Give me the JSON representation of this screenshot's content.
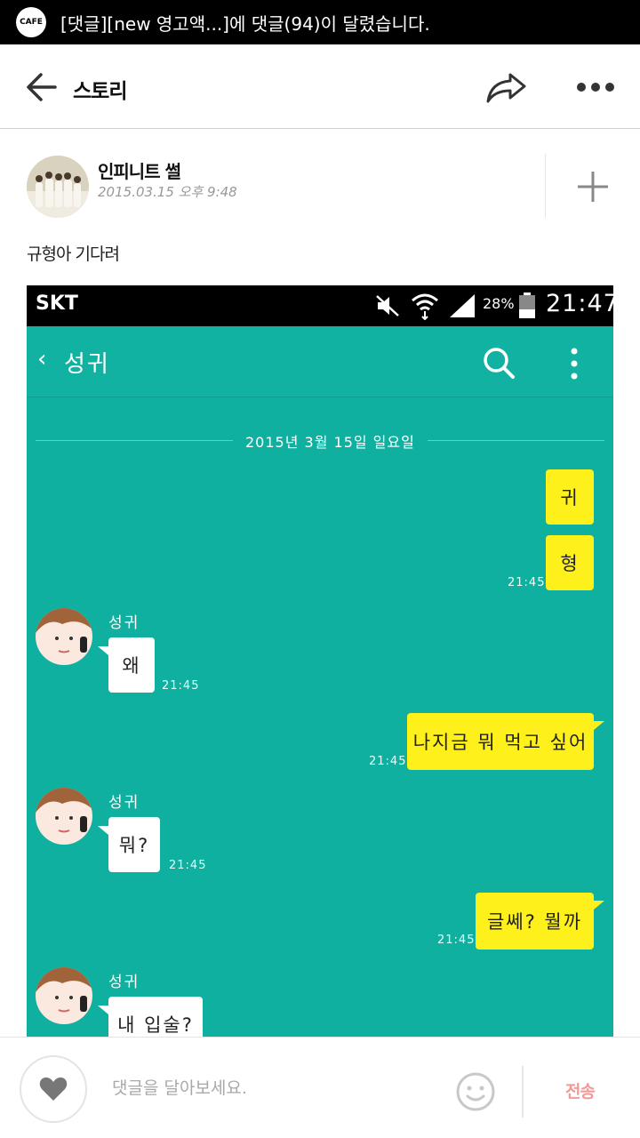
{
  "notification": {
    "text": "[댓글][new 영고액...]에 댓글(94)이 달렸습니다.",
    "app_badge": "CAFE"
  },
  "header": {
    "title": "스토리"
  },
  "post": {
    "author_name": "인피니트 썰",
    "date": "2015.03.15 오후 9:48",
    "body": "규형아 기다려"
  },
  "chat_screenshot": {
    "status_bar": {
      "carrier": "SKT",
      "battery": "28%",
      "time": "21:47"
    },
    "title": "성귀",
    "date_divider": "2015년 3월 15일 일요일",
    "messages": [
      {
        "side": "right",
        "text": "귀",
        "time": ""
      },
      {
        "side": "right",
        "text": "형",
        "time": "21:45"
      },
      {
        "side": "left",
        "sender": "성귀",
        "text": "왜",
        "time": "21:45"
      },
      {
        "side": "right",
        "text": "나지금 뭐 먹고 싶어",
        "time": "21:45"
      },
      {
        "side": "left",
        "sender": "성귀",
        "text": "뭐?",
        "time": "21:45"
      },
      {
        "side": "right",
        "text": "글쎄? 뭘까",
        "time": "21:45"
      },
      {
        "side": "left",
        "sender": "성귀",
        "text": "내 입술?",
        "time": ""
      }
    ]
  },
  "comment_bar": {
    "placeholder": "댓글을 달아보세요.",
    "send_label": "전송"
  },
  "colors": {
    "chat_bg": "#10b0a0",
    "my_bubble": "#fef01b",
    "send": "#f29999"
  }
}
